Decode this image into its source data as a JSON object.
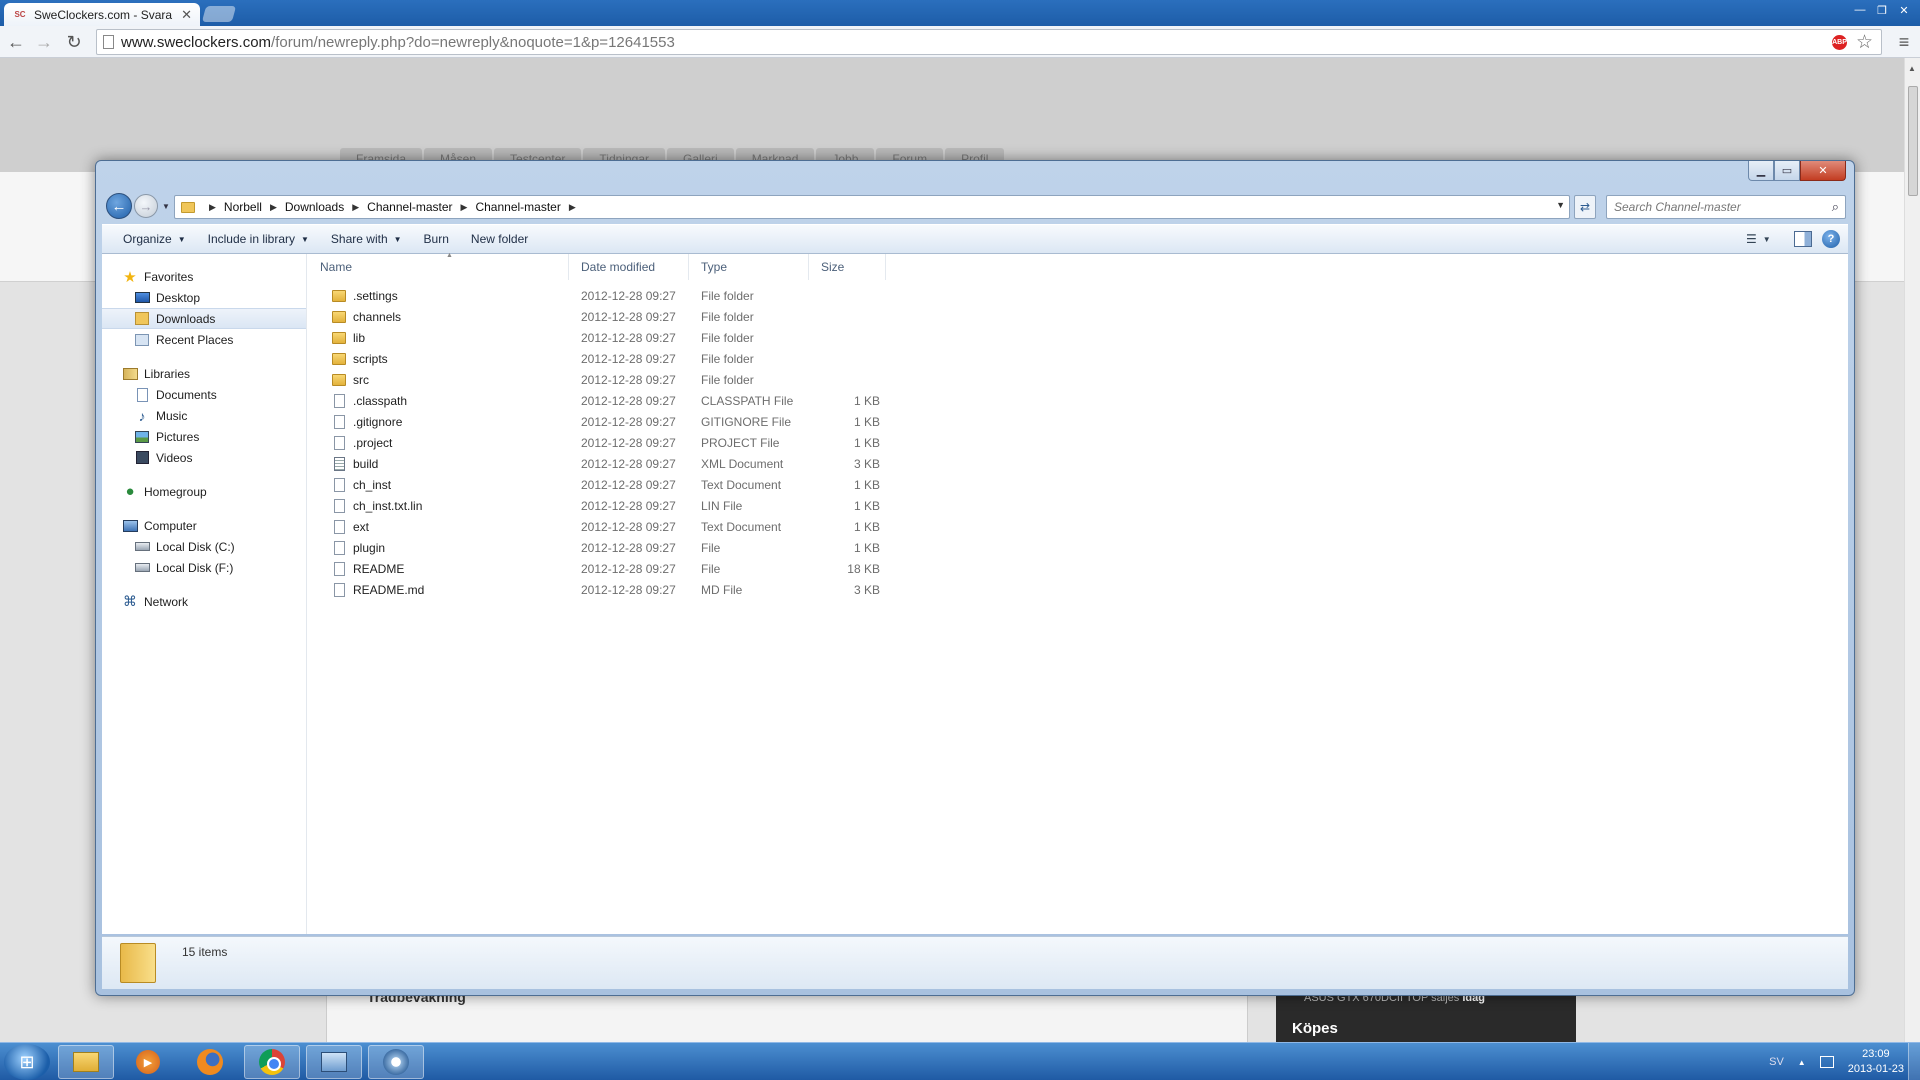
{
  "browser": {
    "tab_title": "SweClockers.com - Svara p",
    "tab_favicon": "SC",
    "url_domain": "www.sweclockers.com",
    "url_path": "/forum/newreply.php?do=newreply&noquote=1&p=12641553",
    "adblock_label": "ABP"
  },
  "webpage": {
    "tabs": [
      "Framsida",
      "Måsen",
      "Testcenter",
      "Tidningar",
      "Galleri",
      "Marknad",
      "Jobb",
      "Forum",
      "Profil"
    ],
    "content_heading": "Trådbevakning",
    "sidebar_line": "ASUS GTX 670DCII TOP säljes",
    "sidebar_line_time": "Idag",
    "sidebar_heading": "Köpes"
  },
  "explorer": {
    "breadcrumbs": [
      "Norbell",
      "Downloads",
      "Channel-master",
      "Channel-master"
    ],
    "search_placeholder": "Search Channel-master",
    "commands": {
      "organize": "Organize",
      "include_in_library": "Include in library",
      "share_with": "Share with",
      "burn": "Burn",
      "new_folder": "New folder"
    },
    "nav": {
      "favorites": "Favorites",
      "desktop": "Desktop",
      "downloads": "Downloads",
      "recent_places": "Recent Places",
      "libraries": "Libraries",
      "documents": "Documents",
      "music": "Music",
      "pictures": "Pictures",
      "videos": "Videos",
      "homegroup": "Homegroup",
      "computer": "Computer",
      "local_disk_c": "Local Disk (C:)",
      "local_disk_f": "Local Disk (F:)",
      "network": "Network"
    },
    "columns": {
      "name": "Name",
      "date_modified": "Date modified",
      "type": "Type",
      "size": "Size"
    },
    "files": [
      {
        "name": ".settings",
        "date": "2012-12-28 09:27",
        "type": "File folder",
        "size": "",
        "icon": "folder"
      },
      {
        "name": "channels",
        "date": "2012-12-28 09:27",
        "type": "File folder",
        "size": "",
        "icon": "folder"
      },
      {
        "name": "lib",
        "date": "2012-12-28 09:27",
        "type": "File folder",
        "size": "",
        "icon": "folder"
      },
      {
        "name": "scripts",
        "date": "2012-12-28 09:27",
        "type": "File folder",
        "size": "",
        "icon": "folder"
      },
      {
        "name": "src",
        "date": "2012-12-28 09:27",
        "type": "File folder",
        "size": "",
        "icon": "folder"
      },
      {
        "name": ".classpath",
        "date": "2012-12-28 09:27",
        "type": "CLASSPATH File",
        "size": "1 KB",
        "icon": "file"
      },
      {
        "name": ".gitignore",
        "date": "2012-12-28 09:27",
        "type": "GITIGNORE File",
        "size": "1 KB",
        "icon": "file"
      },
      {
        "name": ".project",
        "date": "2012-12-28 09:27",
        "type": "PROJECT File",
        "size": "1 KB",
        "icon": "file"
      },
      {
        "name": "build",
        "date": "2012-12-28 09:27",
        "type": "XML Document",
        "size": "3 KB",
        "icon": "xml"
      },
      {
        "name": "ch_inst",
        "date": "2012-12-28 09:27",
        "type": "Text Document",
        "size": "1 KB",
        "icon": "file"
      },
      {
        "name": "ch_inst.txt.lin",
        "date": "2012-12-28 09:27",
        "type": "LIN File",
        "size": "1 KB",
        "icon": "file"
      },
      {
        "name": "ext",
        "date": "2012-12-28 09:27",
        "type": "Text Document",
        "size": "1 KB",
        "icon": "file"
      },
      {
        "name": "plugin",
        "date": "2012-12-28 09:27",
        "type": "File",
        "size": "1 KB",
        "icon": "file"
      },
      {
        "name": "README",
        "date": "2012-12-28 09:27",
        "type": "File",
        "size": "18 KB",
        "icon": "file"
      },
      {
        "name": "README.md",
        "date": "2012-12-28 09:27",
        "type": "MD File",
        "size": "3 KB",
        "icon": "file"
      }
    ],
    "item_count": "15 items"
  },
  "taskbar": {
    "language": "SV",
    "time": "23:09",
    "date": "2013-01-23"
  },
  "colors": {
    "taskbar": "#1f5aa4",
    "explorer_frame": "#bfd3ea",
    "close_button": "#c33d22"
  }
}
